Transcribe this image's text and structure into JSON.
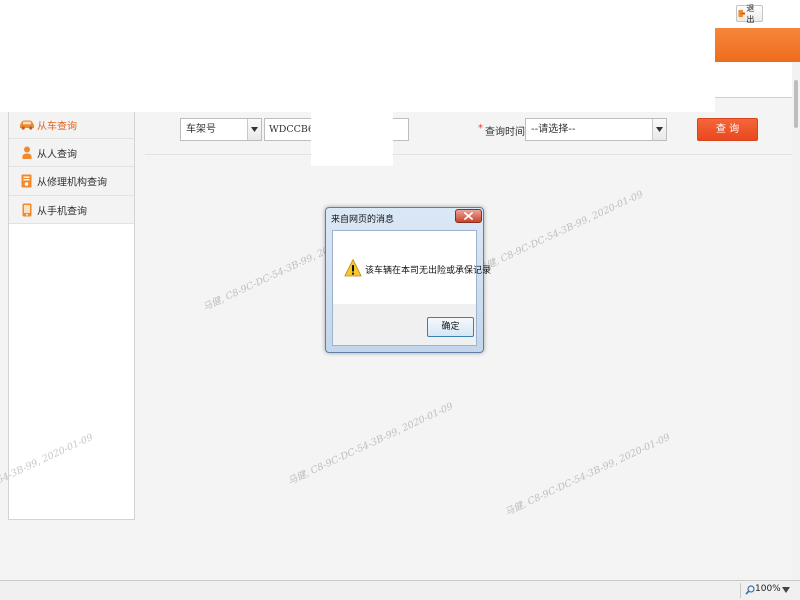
{
  "top_bar": {
    "logout_label": "退出",
    "logout_icon": "logout-icon"
  },
  "sidebar": {
    "items": [
      {
        "label": "从车查询",
        "icon": "car-icon",
        "active": true
      },
      {
        "label": "从人查询",
        "icon": "person-icon",
        "active": false
      },
      {
        "label": "从修理机构查询",
        "icon": "repair-shop-icon",
        "active": false
      },
      {
        "label": "从手机查询",
        "icon": "phone-icon",
        "active": false
      }
    ]
  },
  "query_form": {
    "field_type_select": "车架号",
    "vin_input_value": "WDCCB6DE",
    "required_mark": "*",
    "time_label": "查询时间:",
    "time_select": "--请选择--",
    "query_button": "查 询"
  },
  "dialog": {
    "title": "来自网页的消息",
    "icon": "warning-icon",
    "message": "该车辆在本司无出险或承保记录",
    "ok_button": "确定"
  },
  "status_bar": {
    "zoom": "100%",
    "zoom_icon": "magnifier-icon"
  },
  "watermark_text": "马健, C8-9C-DC-54-3B-99, 2020-01-09",
  "colors": {
    "header_orange": "#ef6b1e",
    "active_nav_text": "#e8651e",
    "query_button": "#e8481f",
    "required_mark": "#e53935",
    "dialog_frame": "#c3d6ec"
  }
}
